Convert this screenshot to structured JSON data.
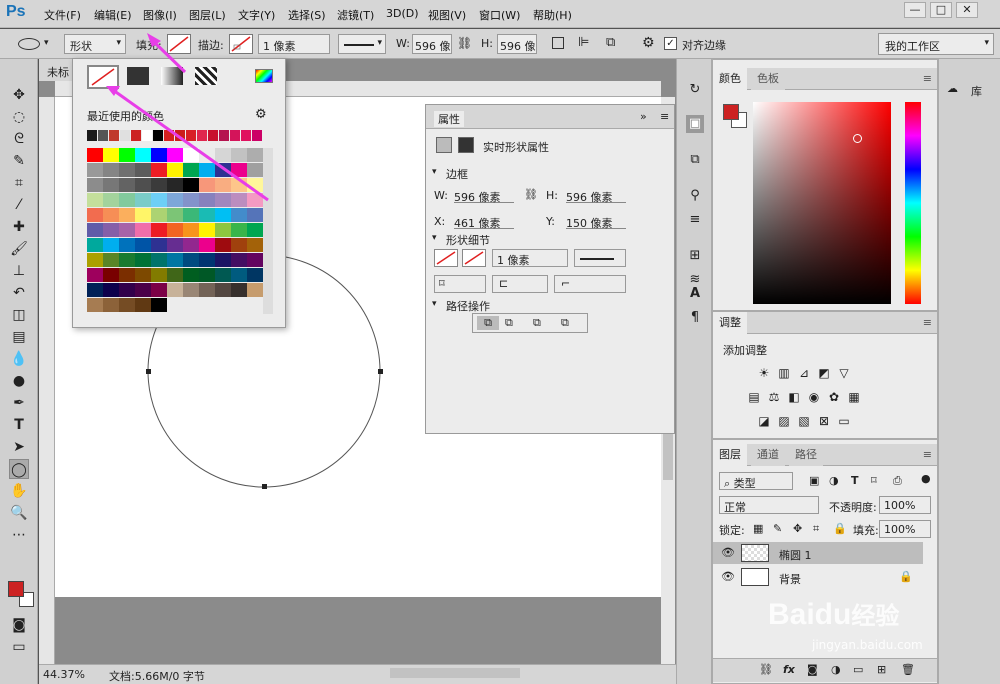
{
  "app": {
    "logo": "Ps"
  },
  "menu": [
    "文件(F)",
    "编辑(E)",
    "图像(I)",
    "图层(L)",
    "文字(Y)",
    "选择(S)",
    "滤镜(T)",
    "3D(D)",
    "视图(V)",
    "窗口(W)",
    "帮助(H)"
  ],
  "window_controls": {
    "minimize": "—",
    "restore": "□",
    "close": "✕"
  },
  "options": {
    "mode": "形状",
    "fill_label": "填充:",
    "stroke_label": "描边:",
    "stroke_width": "1 像素",
    "w_label": "W:",
    "w_value": "596 像素",
    "h_label": "H:",
    "h_value": "596 像素",
    "align_label": "对齐边缘",
    "workspace": "我的工作区"
  },
  "doc_tab": {
    "title": "未标"
  },
  "status": {
    "zoom": "44.37%",
    "doc": "文档:5.66M/0 字节"
  },
  "swatches": {
    "title": "最近使用的颜色",
    "recent": [
      "#1a1a1a",
      "#555555",
      "#c0392b",
      "#e0e0e0",
      "#cc2222",
      "#ffffff",
      "#000000",
      "#d42020",
      "#cc1c1c",
      "#d81f26",
      "#e0264e",
      "#c8102e",
      "#b5134f",
      "#d4145a",
      "#e0115f",
      "#cc0066"
    ],
    "grid": [
      [
        "#ff0000",
        "#ffff00",
        "#00ff00",
        "#00ffff",
        "#0000ff",
        "#ff00ff",
        "#ffffff",
        "#ebebeb",
        "#d6d6d6",
        "#c2c2c2",
        "#adadad"
      ],
      [
        "#999999",
        "#858585",
        "#707070",
        "#5c5c5c",
        "#ed1c24",
        "#fff200",
        "#00a651",
        "#00aeef",
        "#2e3192",
        "#ec008c",
        "#a0a0a0"
      ],
      [
        "#8c8c8c",
        "#777777",
        "#636363",
        "#4f4f4f",
        "#3b3b3b",
        "#262626",
        "#000000",
        "#f7977a",
        "#f9ad81",
        "#fdc68a",
        "#fff79a"
      ],
      [
        "#c4df9b",
        "#a3d39c",
        "#82ca9d",
        "#7accc8",
        "#6dcff6",
        "#7da7d9",
        "#8393ca",
        "#8781bd",
        "#a187be",
        "#bc8dbf",
        "#f49ac2"
      ],
      [
        "#f26c4f",
        "#f68e56",
        "#fbaf5d",
        "#fff568",
        "#acd372",
        "#7cc576",
        "#3bb878",
        "#1abbb4",
        "#00bff3",
        "#438ccb",
        "#5574b9"
      ],
      [
        "#605ca8",
        "#855fa8",
        "#a763a8",
        "#f06eaa",
        "#ed1c24",
        "#f26522",
        "#f7941d",
        "#fff200",
        "#8dc63f",
        "#39b54a",
        "#00a651"
      ],
      [
        "#00a99d",
        "#00aeef",
        "#0072bc",
        "#0054a6",
        "#2e3192",
        "#662d91",
        "#92278f",
        "#ec008c",
        "#9e0b0f",
        "#a0410d",
        "#a36209"
      ],
      [
        "#aba000",
        "#598527",
        "#197b30",
        "#007236",
        "#00746b",
        "#0076a3",
        "#004b80",
        "#003471",
        "#1b1464",
        "#440e62",
        "#630460"
      ],
      [
        "#9e005d",
        "#790000",
        "#7b2e00",
        "#7d4900",
        "#827b00",
        "#406618",
        "#005e20",
        "#005826",
        "#005952",
        "#005b7f",
        "#003663"
      ],
      [
        "#002157",
        "#0d004c",
        "#32004b",
        "#4b0049",
        "#7b0046",
        "#c7b299",
        "#998675",
        "#736357",
        "#534741",
        "#37302d",
        "#c69c6d"
      ],
      [
        "#a67c52",
        "#8c6239",
        "#754c24",
        "#603913",
        "#000000"
      ]
    ]
  },
  "properties": {
    "title": "属性",
    "subtitle": "实时形状属性",
    "section_bbox": "边框",
    "w_label": "W:",
    "w_value": "596 像素",
    "h_label": "H:",
    "h_value": "596 像素",
    "x_label": "X:",
    "x_value": "461 像素",
    "y_label": "Y:",
    "y_value": "150 像素",
    "section_shape": "形状细节",
    "stroke_width": "1 像素",
    "section_path": "路径操作"
  },
  "color_panel": {
    "tabs": [
      "颜色",
      "色板"
    ],
    "fg": "#cc2222",
    "bg": "#ffffff"
  },
  "adjust_panel": {
    "tab": "调整",
    "label": "添加调整"
  },
  "layers_panel": {
    "tabs": [
      "图层",
      "通道",
      "路径"
    ],
    "filter": "类型",
    "blend": "正常",
    "opacity_label": "不透明度:",
    "opacity": "100%",
    "lock_label": "锁定:",
    "fill_label": "填充:",
    "fill": "100%",
    "layers": [
      {
        "name": "椭圆 1",
        "selected": true
      },
      {
        "name": "背景",
        "selected": false
      }
    ]
  },
  "library": {
    "label": "库"
  },
  "watermark": {
    "brand": "Baidu",
    "cn": "经验",
    "url": "jingyan.baidu.com"
  }
}
